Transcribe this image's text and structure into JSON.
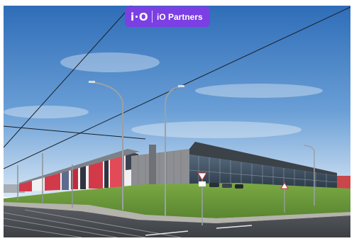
{
  "badge": {
    "logo_text": "i·O",
    "brand_name": "iO Partners",
    "background_color": "#7b3fe4"
  },
  "photo": {
    "colors": {
      "sky_top": "#3a78c2",
      "sky_bottom": "#d6e6f4",
      "grass": "#6f9b3a",
      "road": "#4a4d52",
      "facade_gray": "#8d8f93",
      "glass": "#3a4a5a",
      "mural_red": "#d23a4a",
      "mural_white": "#eef0f2"
    }
  }
}
